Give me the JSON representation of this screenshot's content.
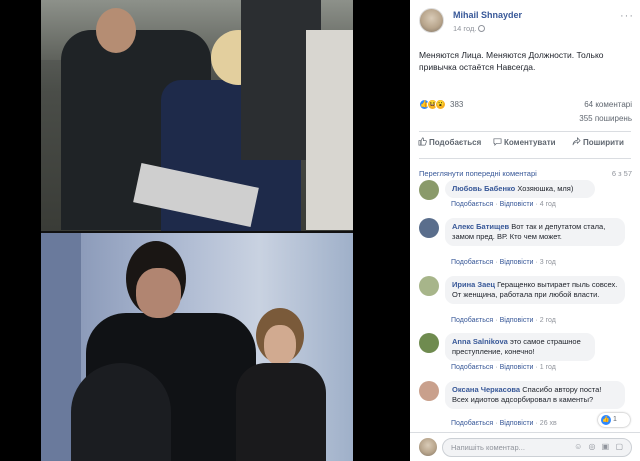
{
  "post": {
    "author": "Mihail Shnayder",
    "time": "14 год.",
    "text": "Меняются Лица. Меняются Должности. Только привычка остаётся Навсегда.",
    "reactions_count": "383",
    "comments_count": "64 коментарі",
    "shares_count": "355 поширень"
  },
  "actions": {
    "like": "Подобається",
    "comment": "Коментувати",
    "share": "Поширити"
  },
  "comments_section": {
    "previous_link": "Переглянути попередні коментарі",
    "pager": "6 з 57"
  },
  "comments": [
    {
      "name": "Любовь Бабенко",
      "text": "Хозяюшка, мля)",
      "like": "Подобається",
      "reply": "Відповісти",
      "time": "4 год",
      "avatar_color": "#8a9a6a"
    },
    {
      "name": "Алекс Батищев",
      "text": "Вот так и депутатом стала, замом пред. ВР. Кто чем может.",
      "like": "Подобається",
      "reply": "Відповісти",
      "time": "3 год",
      "avatar_color": "#5a6e8c"
    },
    {
      "name": "Ирина Заец",
      "text": "Геращенко вытирает пыль совсех. От женщина, работала при любой власти.",
      "like": "Подобається",
      "reply": "Відповісти",
      "time": "2 год",
      "avatar_color": "#a7b58a"
    },
    {
      "name": "Anna Salnikova",
      "text": "это самое страшное преступление, конечно!",
      "like": "Подобається",
      "reply": "Відповісти",
      "time": "1 год",
      "avatar_color": "#6f8b4f"
    },
    {
      "name": "Оксана Черкасова",
      "text": "Спасибо автору поста! Всех идиотов адсорбировал в каменты?",
      "like": "Подобається",
      "reply": "Відповісти",
      "time": "26 хв",
      "avatar_color": "#c9a08c"
    }
  ],
  "message_badge": "1",
  "reply": {
    "placeholder": "Напишіть коментар..."
  }
}
